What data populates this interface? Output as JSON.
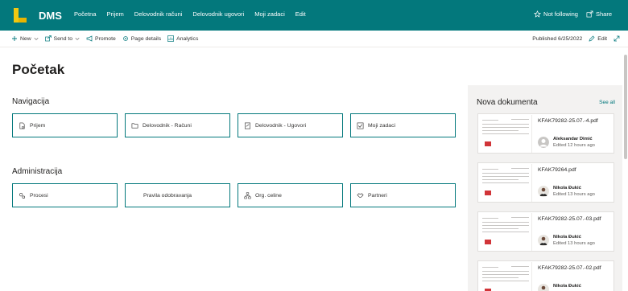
{
  "header": {
    "site_title": "DMS",
    "nav": [
      "Početna",
      "Prijem",
      "Delovodnik računi",
      "Delovodnik ugovori",
      "Moji zadaci",
      "Edit"
    ],
    "not_following": "Not following",
    "share": "Share",
    "bg_color": "#03787c"
  },
  "commandbar": {
    "new": "New",
    "send_to": "Send to",
    "promote": "Promote",
    "page_details": "Page details",
    "analytics": "Analytics",
    "published": "Published 6/25/2022",
    "edit": "Edit"
  },
  "page": {
    "title": "Početak"
  },
  "navigacija": {
    "heading": "Navigacija",
    "tiles": [
      {
        "label": "Prijem",
        "icon": "document-icon"
      },
      {
        "label": "Delovodnik - Računi",
        "icon": "folder-icon"
      },
      {
        "label": "Delovodnik - Ugovori",
        "icon": "signed-document-icon"
      },
      {
        "label": "Moji zadaci",
        "icon": "checkbox-icon"
      }
    ]
  },
  "administracija": {
    "heading": "Administracija",
    "tiles": [
      {
        "label": "Procesi",
        "icon": "gears-icon"
      },
      {
        "label": "Pravila odobravanja",
        "icon": ""
      },
      {
        "label": "Org. celine",
        "icon": "org-chart-icon"
      },
      {
        "label": "Partneri",
        "icon": "handshake-icon"
      }
    ]
  },
  "nova_dokumenta": {
    "heading": "Nova dokumenta",
    "see_all": "See all",
    "docs": [
      {
        "name": "KFAK79282-25.07.-4.pdf",
        "author": "Aleksandar Dimić",
        "edited": "Edited 12 hours ago",
        "avatar": "placeholder"
      },
      {
        "name": "KFAK79264.pdf",
        "author": "Nikola Đukić",
        "edited": "Edited 13 hours ago",
        "avatar": "photo"
      },
      {
        "name": "KFAK79282-25.07.-03.pdf",
        "author": "Nikola Đukić",
        "edited": "Edited 13 hours ago",
        "avatar": "photo"
      },
      {
        "name": "KFAK79282-25.07.-02.pdf",
        "author": "Nikola Đukić",
        "edited": "",
        "avatar": "photo"
      }
    ]
  }
}
